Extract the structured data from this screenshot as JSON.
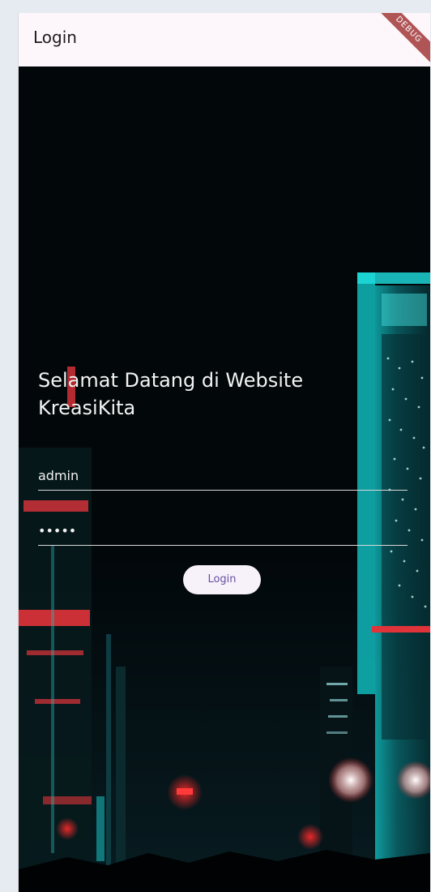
{
  "appbar": {
    "title": "Login",
    "debug_banner": "DEBUG"
  },
  "login": {
    "welcome_text": "Selamat Datang di Website KreasiKita",
    "username_value": "admin",
    "password_value": "•••••",
    "button_label": "Login"
  },
  "colors": {
    "appbar_bg": "#fdf6fb",
    "button_text": "#6750a4",
    "button_bg": "#f7f1fa",
    "debug_banner": "#a33a3a",
    "scene_bg": "#020406"
  }
}
